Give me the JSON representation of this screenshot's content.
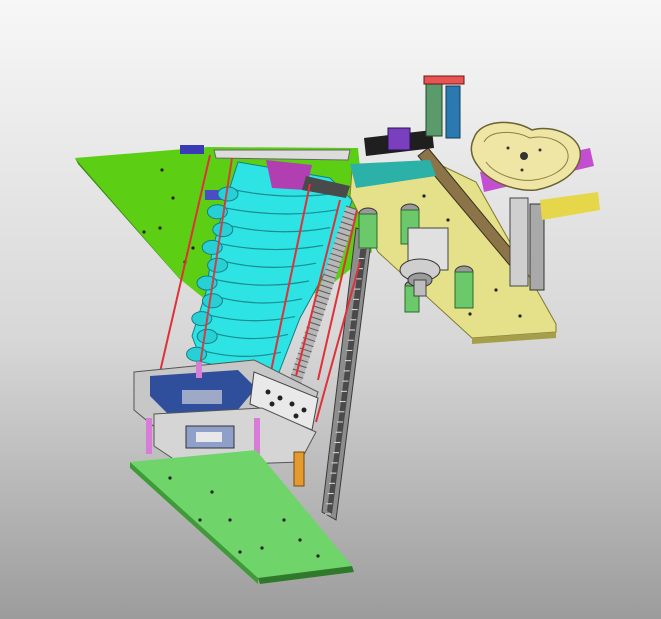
{
  "view": {
    "background_top": "#f7f7f7",
    "background_bottom": "#9c9c9c"
  },
  "model": {
    "parts": {
      "upper_mount_plate": {
        "color": "#5ccf14"
      },
      "lower_base_plate": {
        "color": "#6fd46a"
      },
      "bellows_cover": {
        "color": "#2ee3e3",
        "folds": 11
      },
      "right_mount_plate": {
        "color": "#e5e08a"
      },
      "heart_plate": {
        "color": "#efe6a6"
      },
      "guide_rods": {
        "color": "#e0303a"
      },
      "ball_screw": {
        "color": "#b7b7b7"
      },
      "linear_rail": {
        "color": "#8d8d8d"
      },
      "clamp_block": {
        "color": "#2f4f9c"
      },
      "support_posts": {
        "color": "#d77cd7"
      },
      "cylinders": {
        "color": "#6bc86b"
      },
      "motor_housing": {
        "color": "#e0e0e0"
      },
      "top_actuator_block": {
        "color": "#2bb1a8"
      }
    }
  }
}
